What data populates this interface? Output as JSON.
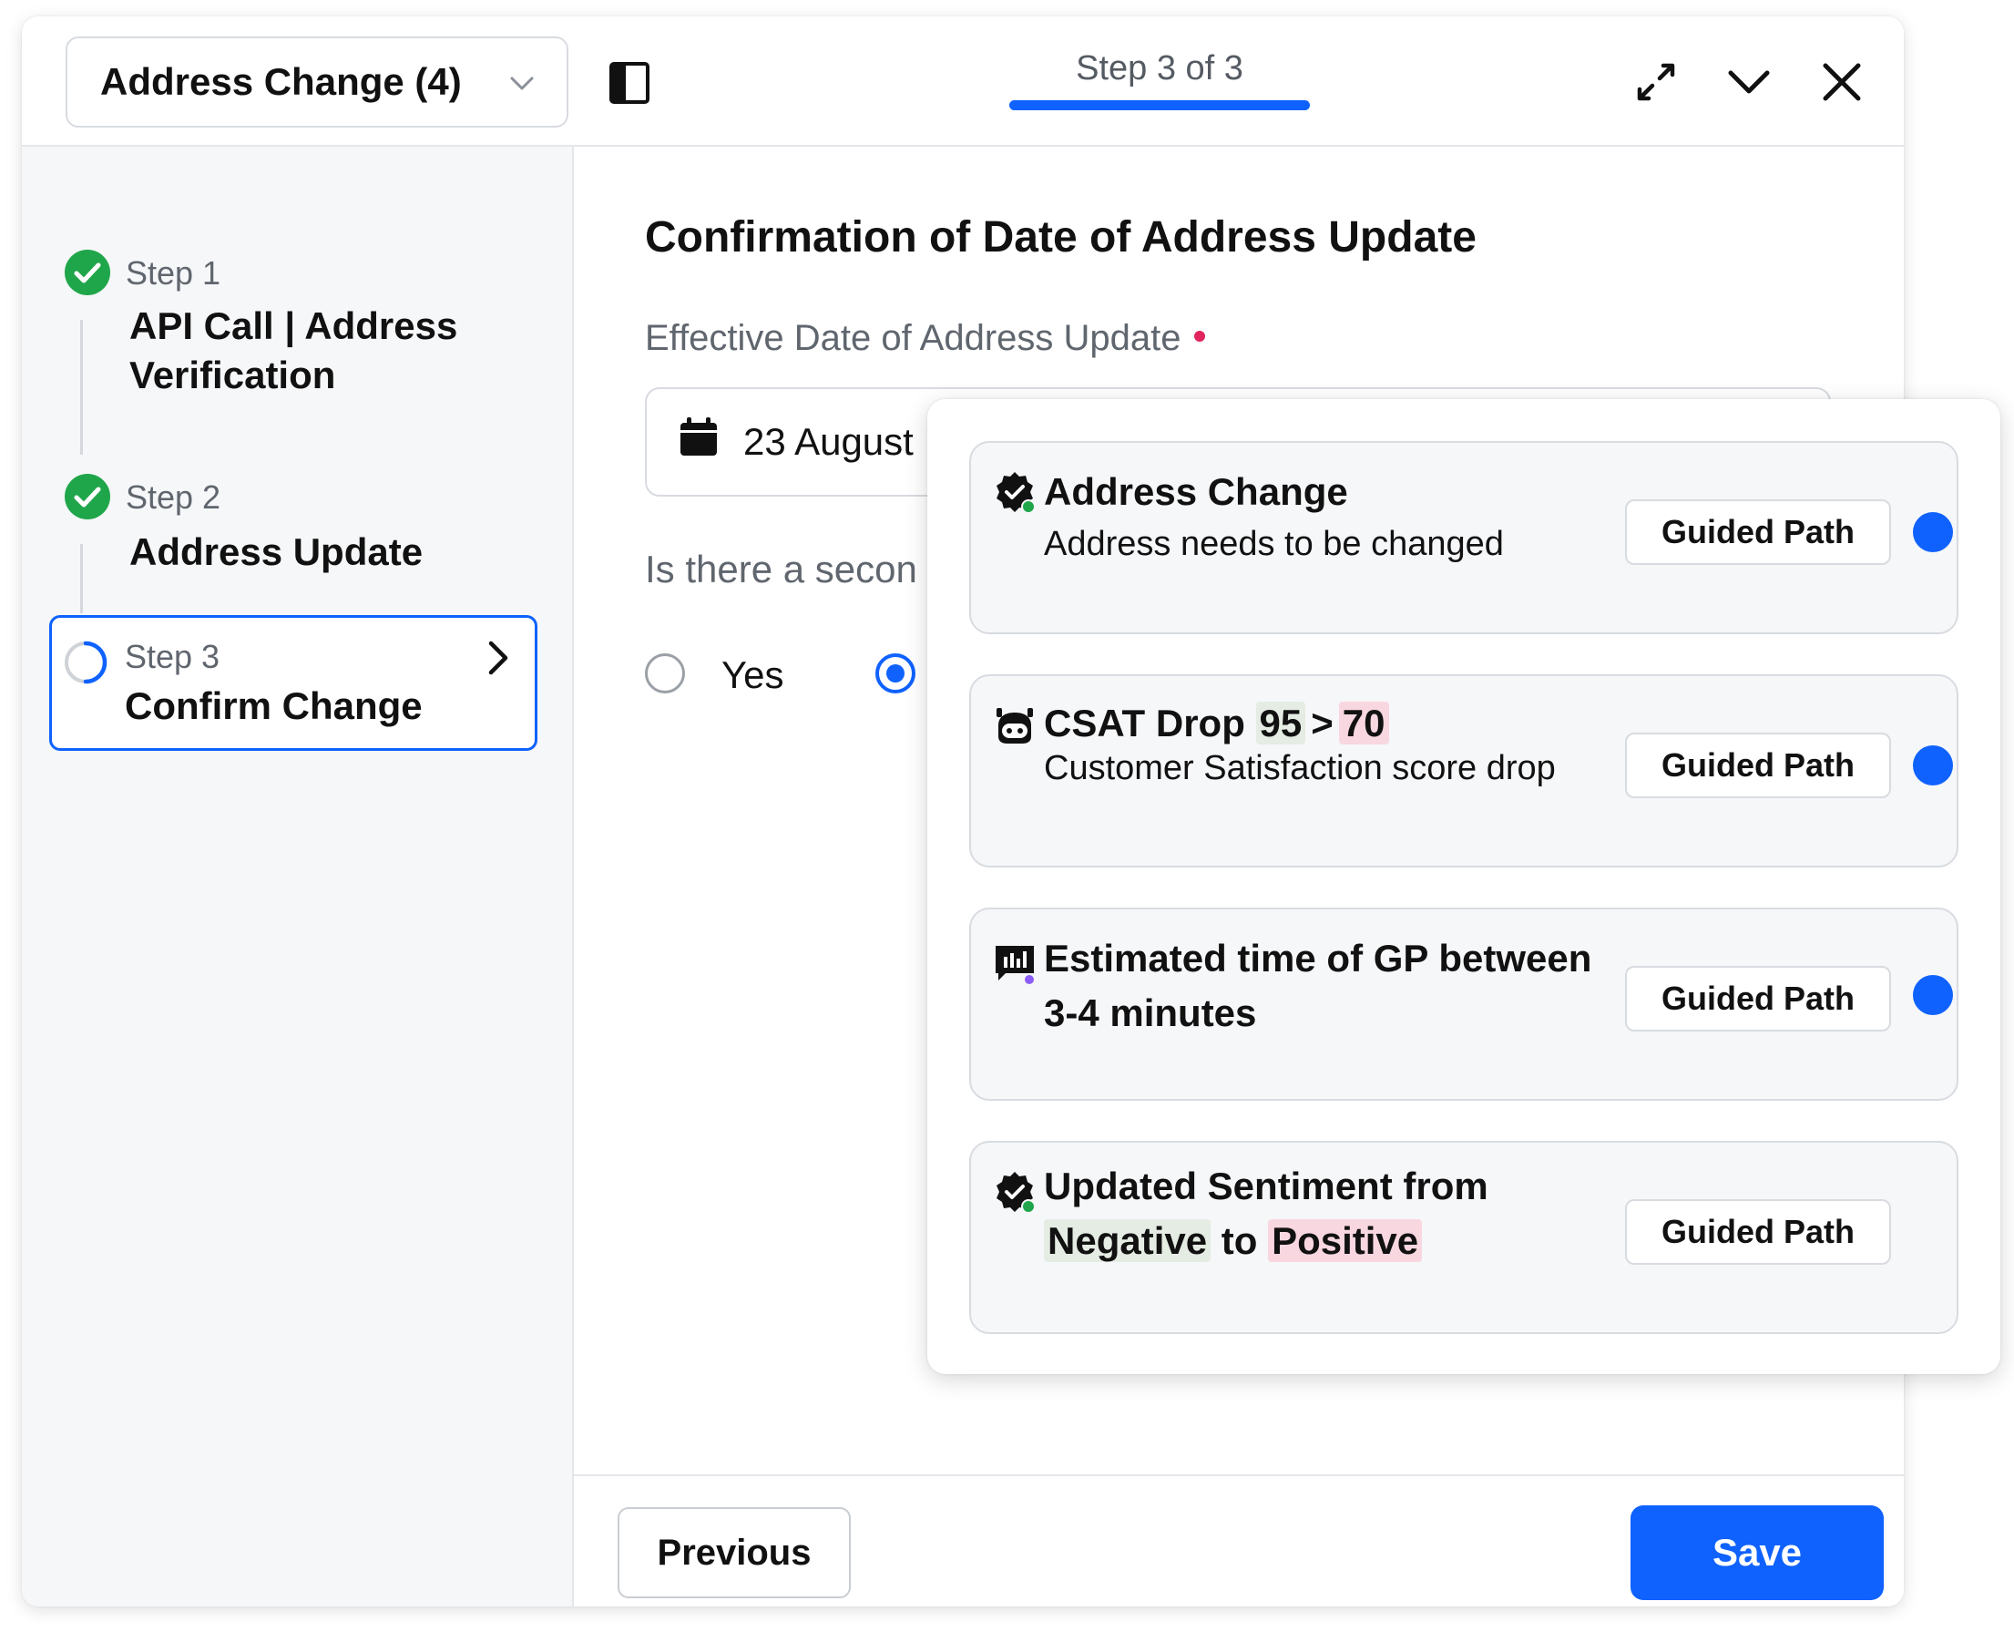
{
  "header": {
    "case_title": "Address Change (4)",
    "step_indicator": "Step 3 of 3"
  },
  "sidebar": {
    "steps": [
      {
        "label": "Step 1",
        "title_line1": "API Call | Address",
        "title_line2": "Verification",
        "status": "complete"
      },
      {
        "label": "Step 2",
        "title": "Address Update",
        "status": "complete"
      },
      {
        "label": "Step 3",
        "title": "Confirm Change",
        "status": "in-progress"
      }
    ]
  },
  "form": {
    "title": "Confirmation of Date of Address Update",
    "date_field": {
      "label": "Effective Date of Address Update",
      "value": "23 August"
    },
    "question": "Is there a secon",
    "options": [
      "Yes"
    ]
  },
  "footer": {
    "previous_label": "Previous",
    "save_label": "Save"
  },
  "popover": {
    "cards": [
      {
        "title": "Address Change",
        "subtitle": "Address needs to be changed",
        "button": "Guided Path",
        "icon": "verified-badge-icon"
      },
      {
        "title_prefix": "CSAT Drop ",
        "from": "95",
        "arrow": ">",
        "to": "70",
        "subtitle": "Customer Satisfaction score drop",
        "button": "Guided Path",
        "icon": "bot-icon"
      },
      {
        "title_line1": "Estimated time of GP between",
        "title_line2": "3-4 minutes",
        "button": "Guided Path",
        "icon": "chart-message-icon"
      },
      {
        "title_line1": "Updated Sentiment from",
        "from": "Negative",
        "connector": " to ",
        "to": "Positive",
        "button": "Guided Path",
        "icon": "verified-badge-icon"
      }
    ]
  },
  "colors": {
    "accent": "#0f62fe",
    "success": "#1fa64a",
    "required": "#e0245e"
  }
}
